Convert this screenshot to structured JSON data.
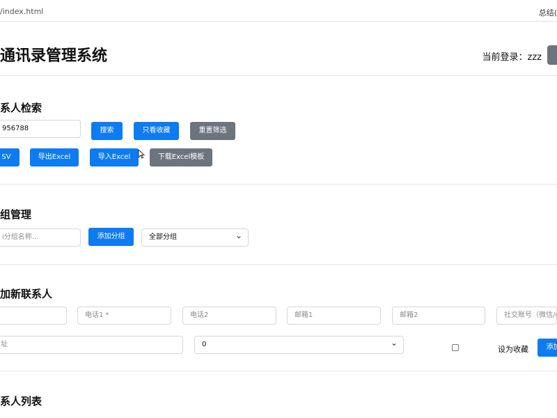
{
  "topbar": {
    "address": "/index.html",
    "right_label": "总结("
  },
  "header": {
    "title": "通讯录管理系统",
    "login_text": "当前登录：zzz"
  },
  "search": {
    "heading": "系人检索",
    "query_value": "956788",
    "buttons": {
      "search": "搜索",
      "favorites_only": "只看收藏",
      "reset_filters": "重置筛选",
      "csv": "SV",
      "export_excel": "导出Excel",
      "import_excel": "导入Excel",
      "download_template": "下载Excel模板"
    }
  },
  "groups": {
    "heading": "组管理",
    "name_placeholder": "i分组名称...",
    "add_button": "添加分组",
    "filter_selected": "全部分组"
  },
  "add_contact": {
    "heading": "加新联系人",
    "fields": {
      "name_placeholder": "",
      "phone1_placeholder": "电话1 *",
      "phone2_placeholder": "电话2",
      "email1_placeholder": "邮箱1",
      "email2_placeholder": "邮箱2",
      "social_placeholder": "社交账号（微信/(",
      "address_placeholder": "址",
      "group_selected": "0"
    },
    "favorite_label": "设为收藏",
    "submit_label": "添加"
  },
  "list": {
    "heading": "系人列表"
  }
}
